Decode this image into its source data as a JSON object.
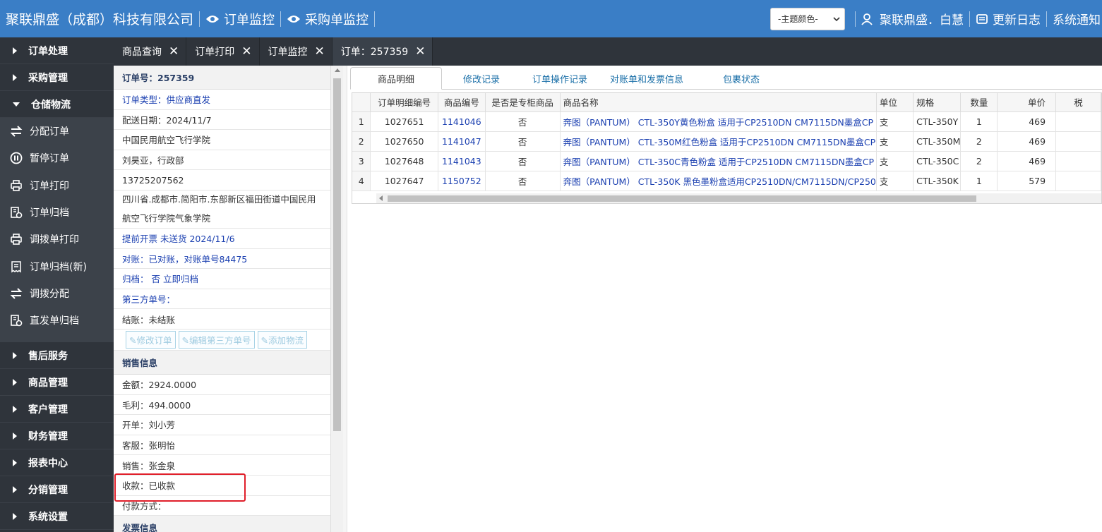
{
  "header": {
    "company": "聚联鼎盛（成都）科技有限公司",
    "nav": [
      "订单监控",
      "采购单监控"
    ],
    "theme_select": "-主题颜色-",
    "user": "聚联鼎盛．白慧",
    "changelog": "更新日志",
    "notice": "系统通知"
  },
  "sidebar": {
    "groups_top": [
      "订单处理",
      "采购管理"
    ],
    "open_group": "仓储物流",
    "items": [
      "分配订单",
      "暂停订单",
      "订单打印",
      "订单归档",
      "调拨单打印",
      "订单归档(新)",
      "调拨分配",
      "直发单归档"
    ],
    "groups_bottom": [
      "售后服务",
      "商品管理",
      "客户管理",
      "财务管理",
      "报表中心",
      "分销管理",
      "系统设置"
    ]
  },
  "tabs": [
    {
      "label": "商品查询"
    },
    {
      "label": "订单打印"
    },
    {
      "label": "订单监控"
    },
    {
      "label": "订单：257359"
    }
  ],
  "order": {
    "title": "订单号：257359",
    "type": "订单类型：供应商直发",
    "delivery_date": "配送日期：2024/11/7",
    "customer": "中国民用航空飞行学院",
    "contact": "刘昊亚，行政部",
    "phone": "13725207562",
    "address": "四川省.成都市.简阳市.东部新区福田街道中国民用航空飞行学院气象学院",
    "invoice_status": "提前开票 未送货 2024/11/6",
    "reconcile": "对账：已对账，对账单号84475",
    "archive": "归档：  否 立即归档",
    "third_party": "第三方单号：",
    "settle": "结账：未结账",
    "buttons": [
      "修改订单",
      "编辑第三方单号",
      "添加物流"
    ]
  },
  "sales": {
    "header": "销售信息",
    "amount": "金额：2924.0000",
    "profit": "毛利：494.0000",
    "issuer": "开单：刘小芳",
    "service": "客服：张明怡",
    "seller": "销售：张金泉",
    "payment_status": "收款：已收款",
    "payment_method": "付款方式："
  },
  "invoice_header": "发票信息",
  "subtabs": [
    "商品明细",
    "修改记录",
    "订单操作记录",
    "对账单和发票信息",
    "包裹状态"
  ],
  "table": {
    "columns": [
      "订单明细编号",
      "商品编号",
      "是否是专柜商品",
      "商品名称",
      "单位",
      "规格",
      "数量",
      "单价",
      "税"
    ],
    "rows": [
      {
        "n": "1",
        "detail_id": "1027651",
        "sku": "1141046",
        "counter": "否",
        "name": "奔图（PANTUM） CTL-350Y黄色粉盒 适用于CP2510DN CM7115DN墨盒CP",
        "unit": "支",
        "spec": "CTL-350Y",
        "qty": "1",
        "price": "469"
      },
      {
        "n": "2",
        "detail_id": "1027650",
        "sku": "1141047",
        "counter": "否",
        "name": "奔图（PANTUM） CTL-350M红色粉盒 适用于CP2510DN CM7115DN墨盒CP",
        "unit": "支",
        "spec": "CTL-350M",
        "qty": "2",
        "price": "469"
      },
      {
        "n": "3",
        "detail_id": "1027648",
        "sku": "1141043",
        "counter": "否",
        "name": "奔图（PANTUM） CTL-350C青色粉盒 适用于CP2510DN CM7115DN墨盒CP",
        "unit": "支",
        "spec": "CTL-350C",
        "qty": "2",
        "price": "469"
      },
      {
        "n": "4",
        "detail_id": "1027647",
        "sku": "1150752",
        "counter": "否",
        "name": "奔图（PANTUM） CTL-350K 黑色墨粉盒适用CP2510DN/CM7115DN/CP250",
        "unit": "支",
        "spec": "CTL-350K",
        "qty": "1",
        "price": "579"
      }
    ]
  }
}
